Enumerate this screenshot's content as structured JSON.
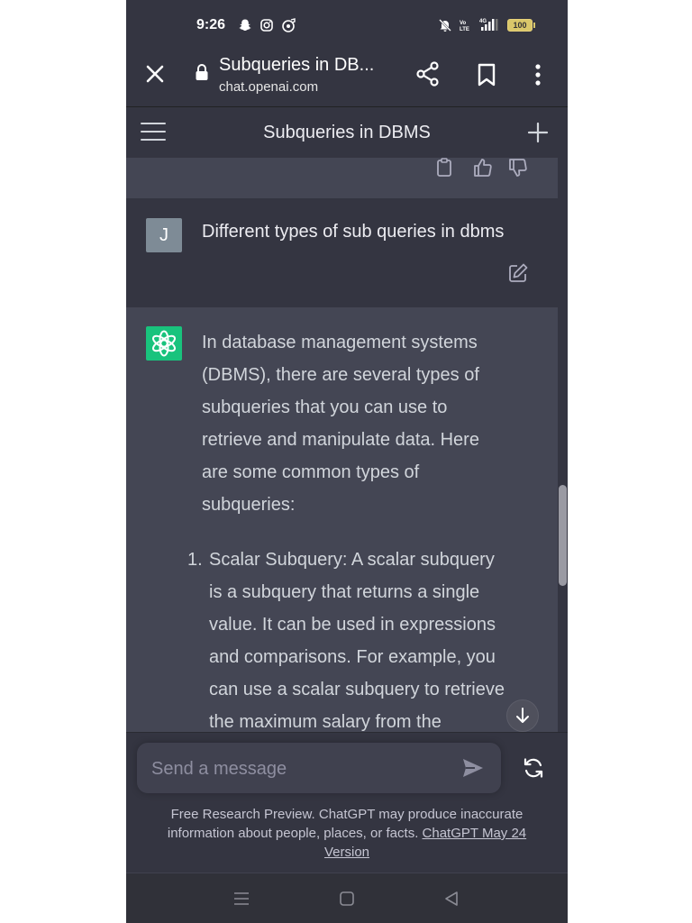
{
  "status_bar": {
    "time": "9:26",
    "battery": "100"
  },
  "browser": {
    "page_title": "Subqueries in DB...",
    "domain": "chat.openai.com"
  },
  "app_header": {
    "title": "Subqueries in DBMS"
  },
  "conversation": {
    "user_avatar_letter": "J",
    "user_message": "Different types of sub queries in dbms",
    "assistant_intro": "In database management systems\n(DBMS), there are several types of\nsubqueries that you can use to\nretrieve and manipulate data. Here\nare some common types of\nsubqueries:",
    "list_item_number": "1.",
    "list_item_text": "Scalar Subquery: A scalar subquery\nis a subquery that returns a single\nvalue. It can be used in expressions\nand comparisons. For example, you\ncan use a scalar subquery to retrieve\nthe maximum salary from the"
  },
  "composer": {
    "placeholder": "Send a message"
  },
  "disclaimer": {
    "text": "Free Research Preview. ChatGPT may produce inaccurate information about people, places, or facts.",
    "link_text": "ChatGPT May 24 Version"
  },
  "colors": {
    "background": "#343541",
    "assistant_background": "#444654",
    "brand": "#19c37d"
  },
  "icons": [
    "close-icon",
    "lock-icon",
    "share-icon",
    "bookmark-icon",
    "more-icon",
    "menu-icon",
    "new-chat-icon",
    "copy-icon",
    "thumbs-up-icon",
    "thumbs-down-icon",
    "edit-icon",
    "openai-logo-icon",
    "scroll-down-icon",
    "send-icon",
    "regenerate-icon"
  ]
}
